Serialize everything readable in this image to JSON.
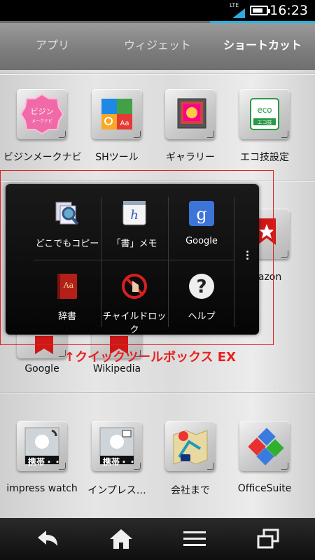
{
  "status_bar": {
    "network": "LTE",
    "time": "16:23"
  },
  "tabs": [
    {
      "label": "アプリ",
      "active": false
    },
    {
      "label": "ウィジェット",
      "active": false
    },
    {
      "label": "ショートカット",
      "active": true
    }
  ],
  "shortcuts_row1": [
    {
      "label": "ビジンメークナビ",
      "icon": "bijin-icon"
    },
    {
      "label": "SHツール",
      "icon": "sh-tool-icon"
    },
    {
      "label": "ギャラリー",
      "icon": "gallery-icon"
    },
    {
      "label": "エコ技設定",
      "icon": "eco-icon"
    }
  ],
  "shortcuts_row2_partial": {
    "label": "nazon"
  },
  "shortcuts_row3": [
    {
      "label": "Google",
      "icon": "bookmark-icon"
    },
    {
      "label": "Wikipedia",
      "icon": "bookmark-icon"
    }
  ],
  "shortcuts_row4": [
    {
      "label": "impress watch",
      "badge": "携帯・・",
      "icon": "contact-phone-icon"
    },
    {
      "label": "インプレス…",
      "badge": "携帯・・",
      "icon": "contact-message-icon"
    },
    {
      "label": "会社まで",
      "icon": "map-route-icon"
    },
    {
      "label": "OfficeSuite",
      "icon": "officesuite-icon"
    }
  ],
  "quick_toolbox": {
    "items": [
      {
        "label": "どこでもコピー",
        "icon": "copy-search-icon"
      },
      {
        "label": "「書」メモ",
        "icon": "memo-icon"
      },
      {
        "label": "Google",
        "icon": "google-icon"
      },
      {
        "label": "辞書",
        "icon": "dictionary-icon"
      },
      {
        "label": "チャイルドロック",
        "icon": "child-lock-icon"
      },
      {
        "label": "ヘルプ",
        "icon": "help-icon"
      }
    ]
  },
  "annotation": {
    "caption": "↑クイックツールボックス EX"
  },
  "navigation": [
    "back-icon",
    "home-icon",
    "menu-icon",
    "recent-apps-icon"
  ],
  "colors": {
    "accent": "#1bb7e8",
    "annotation_red": "#e02020"
  }
}
